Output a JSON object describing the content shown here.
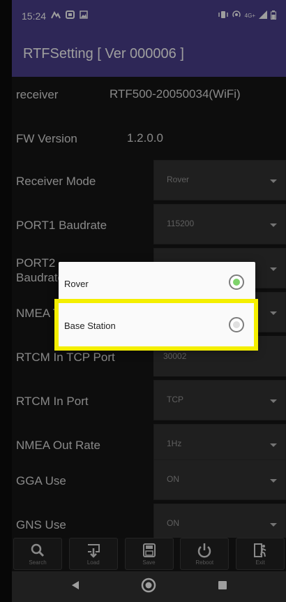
{
  "status_bar": {
    "time": "15:24",
    "network": "4G+"
  },
  "app": {
    "title": "RTFSetting",
    "version": "[ Ver 000006 ]"
  },
  "fields": [
    {
      "label": "receiver",
      "value": "RTF500-20050034(WiFi)",
      "type": "text"
    },
    {
      "label": "FW Version",
      "value": "1.2.0.0",
      "type": "text"
    },
    {
      "label": "Receiver Mode",
      "value": "Rover",
      "type": "dropdown"
    },
    {
      "label": "PORT1 Baudrate",
      "value": "115200",
      "type": "dropdown"
    },
    {
      "label": "PORT2 Baudrate",
      "value": "",
      "type": "dropdown"
    },
    {
      "label": "NMEA T",
      "value": "",
      "type": "dropdown"
    },
    {
      "label": "RTCM In TCP Port",
      "value": "30002",
      "type": "input"
    },
    {
      "label": "RTCM In Port",
      "value": "TCP",
      "type": "dropdown"
    },
    {
      "label": "NMEA Out Rate",
      "value": "1Hz",
      "type": "dropdown"
    },
    {
      "label": "GGA Use",
      "value": "ON",
      "type": "dropdown"
    },
    {
      "label": "GNS Use",
      "value": "ON",
      "type": "dropdown"
    }
  ],
  "dialog": {
    "options": [
      {
        "label": "Rover",
        "selected": true
      },
      {
        "label": "Base Station",
        "selected": false
      }
    ]
  },
  "toolbar": [
    {
      "label": "Search",
      "icon": "search-icon"
    },
    {
      "label": "Load",
      "icon": "load-icon"
    },
    {
      "label": "Save",
      "icon": "save-icon"
    },
    {
      "label": "Reboot",
      "icon": "power-icon"
    },
    {
      "label": "Exit",
      "icon": "exit-icon"
    }
  ],
  "colors": {
    "title_bar": "#4b3f8d",
    "radio_selected": "#7ed36b",
    "highlight": "#f4ef00"
  }
}
